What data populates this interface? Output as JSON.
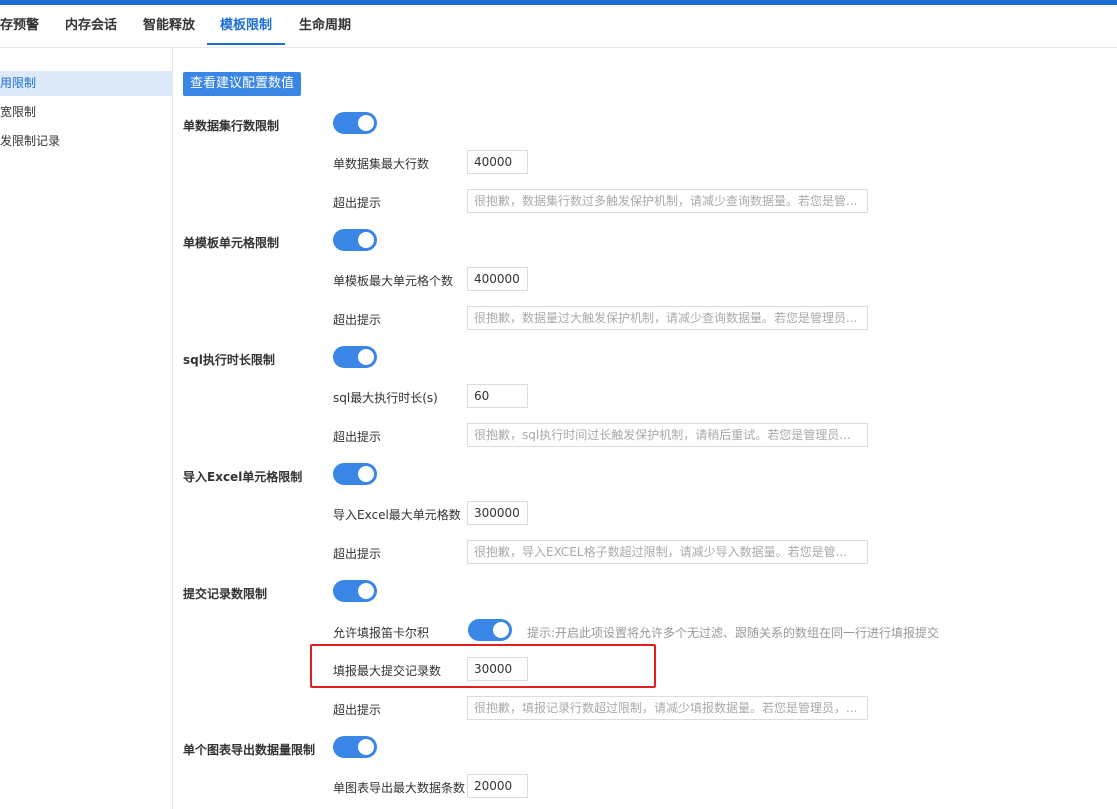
{
  "tabs": [
    {
      "label": "存预警"
    },
    {
      "label": "内存会话"
    },
    {
      "label": "智能释放"
    },
    {
      "label": "模板限制"
    },
    {
      "label": "生命周期"
    }
  ],
  "active_tab": "模板限制",
  "sidebar": {
    "items": [
      {
        "label": "用限制"
      },
      {
        "label": "宽限制"
      },
      {
        "label": "发限制记录"
      }
    ]
  },
  "toolbar": {
    "view_config_label": "查看建议配置数值"
  },
  "sections": {
    "dataset_rows": {
      "title": "单数据集行数限制",
      "enabled": true,
      "max_label": "单数据集最大行数",
      "max_value": "40000",
      "hint_label": "超出提示",
      "hint_value": "很抱歉，数据集行数过多触发保护机制，请减少查询数据量。若您是管..."
    },
    "template_cells": {
      "title": "单模板单元格限制",
      "enabled": true,
      "max_label": "单模板最大单元格个数",
      "max_value": "400000",
      "hint_label": "超出提示",
      "hint_value": "很抱歉，数据量过大触发保护机制，请减少查询数据量。若您是管理员..."
    },
    "sql_time": {
      "title": "sql执行时长限制",
      "enabled": true,
      "max_label": "sql最大执行时长(s)",
      "max_value": "60",
      "hint_label": "超出提示",
      "hint_value": "很抱歉，sql执行时间过长触发保护机制，请稍后重试。若您是管理员..."
    },
    "excel_cells": {
      "title": "导入Excel单元格限制",
      "enabled": true,
      "max_label": "导入Excel最大单元格数",
      "max_value": "300000",
      "hint_label": "超出提示",
      "hint_value": "很抱歉，导入EXCEL格子数超过限制，请减少导入数据量。若您是管..."
    },
    "submit_records": {
      "title": "提交记录数限制",
      "enabled": true,
      "cartesian_label": "允许填报笛卡尔积",
      "cartesian_enabled": true,
      "cartesian_tip": "提示:开启此项设置将允许多个无过滤、跟随关系的数组在同一行进行填报提交",
      "max_label": "填报最大提交记录数",
      "max_value": "30000",
      "hint_label": "超出提示",
      "hint_value": "很抱歉，填报记录行数超过限制，请减少填报数据量。若您是管理员，..."
    },
    "chart_export": {
      "title": "单个图表导出数据量限制",
      "enabled": true,
      "max_label": "单图表导出最大数据条数",
      "max_value": "20000"
    }
  },
  "colors": {
    "accent": "#3a86e6",
    "highlight": "#e02020"
  }
}
